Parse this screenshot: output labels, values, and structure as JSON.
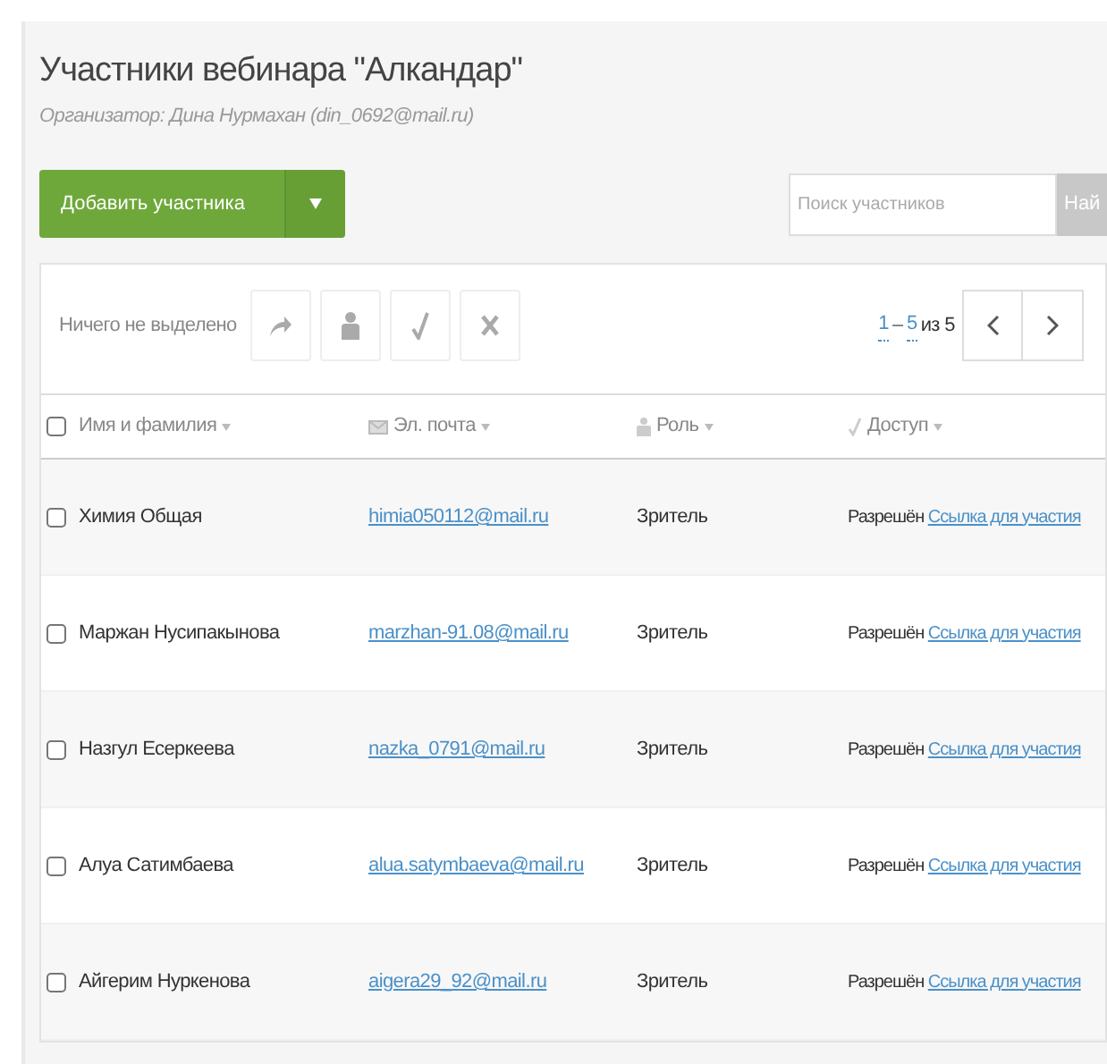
{
  "title": "Участники вебинара \"Алкандар\"",
  "organizer": "Организатор: Дина Нурмахан (din_0692@mail.ru)",
  "add_button": {
    "label": "Добавить участника"
  },
  "search": {
    "placeholder": "Поиск участников",
    "button": "Най"
  },
  "toolbar": {
    "selection_text": "Ничего не выделено",
    "pager": {
      "from": "1",
      "to": "5",
      "total": "из 5"
    }
  },
  "columns": [
    {
      "label": "Имя и фамилия",
      "kind": "checkbox",
      "checked": false
    },
    {
      "label": "Эл. почта",
      "kind": "mail"
    },
    {
      "label": "Роль",
      "kind": "person"
    },
    {
      "label": "Доступ",
      "kind": "tick"
    }
  ],
  "rows": [
    {
      "name": "Химия Общая",
      "email": "himia050112@mail.ru",
      "role": "Зритель",
      "access": "Разрешён",
      "link": "Ссылка для участия",
      "checked": false
    },
    {
      "name": "Маржан Нусипакынова",
      "email": "marzhan-91.08@mail.ru",
      "role": "Зритель",
      "access": "Разрешён",
      "link": "Ссылка для участия",
      "checked": false
    },
    {
      "name": "Назгул Есеркеева",
      "email": "nazka_0791@mail.ru",
      "role": "Зритель",
      "access": "Разрешён",
      "link": "Ссылка для участия",
      "checked": false
    },
    {
      "name": "Алуа Сатимбаева",
      "email": "alua.satymbaeva@mail.ru",
      "role": "Зритель",
      "access": "Разрешён",
      "link": "Ссылка для участия",
      "checked": false
    },
    {
      "name": "Айгерим Нуркенова",
      "email": "aigera29_92@mail.ru",
      "role": "Зритель",
      "access": "Разрешён",
      "link": "Ссылка для участия",
      "checked": false
    }
  ]
}
